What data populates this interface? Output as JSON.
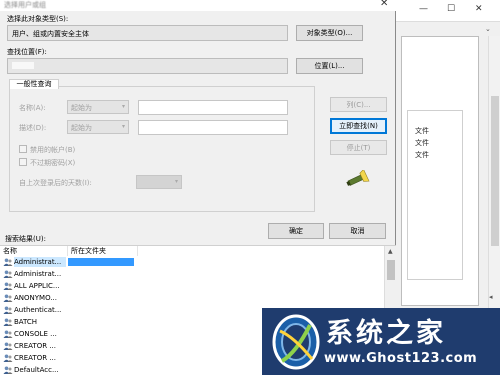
{
  "dialog": {
    "title": "选择用户或组",
    "object_type_label": "选择此对象类型(S):",
    "object_type_value": "用户、组或内置安全主体",
    "object_type_button": "对象类型(O)...",
    "location_label": "查找位置(F):",
    "location_value": "",
    "location_button": "位置(L)...",
    "tab_label": "一般性查询",
    "name_label": "名称(A):",
    "name_combo": "起始为",
    "desc_label": "描述(D):",
    "desc_combo": "起始为",
    "column_button": "列(C)...",
    "find_now_button": "立即查找(N)",
    "stop_button": "停止(T)",
    "disabled_accounts_label": "禁用的帐户(B)",
    "non_expiring_label": "不过期密码(X)",
    "days_since_label": "自上次登录后的天数(I):",
    "ok_button": "确定",
    "cancel_button": "取消",
    "results_label": "搜索结果(U):",
    "columns": [
      "名称",
      "所在文件夹"
    ],
    "results": [
      {
        "name": "Administrat...",
        "selected": true
      },
      {
        "name": "Administrat...",
        "selected": false
      },
      {
        "name": "ALL APPLIC...",
        "selected": false
      },
      {
        "name": "ANONYMO...",
        "selected": false
      },
      {
        "name": "Authenticat...",
        "selected": false
      },
      {
        "name": "BATCH",
        "selected": false
      },
      {
        "name": "CONSOLE ...",
        "selected": false
      },
      {
        "name": "CREATOR ...",
        "selected": false
      },
      {
        "name": "CREATOR ...",
        "selected": false
      },
      {
        "name": "DefaultAcc...",
        "selected": false
      }
    ]
  },
  "background_window": {
    "file_labels": [
      "文件",
      "文件",
      "文件"
    ]
  },
  "watermark": {
    "title": "系统之家",
    "url": "www.Ghost123.com"
  },
  "colors": {
    "selection": "#cce8ff",
    "selection_folder": "#3399ff",
    "focus_border": "#0078d7",
    "watermark_bg": "#1f3c6e"
  }
}
